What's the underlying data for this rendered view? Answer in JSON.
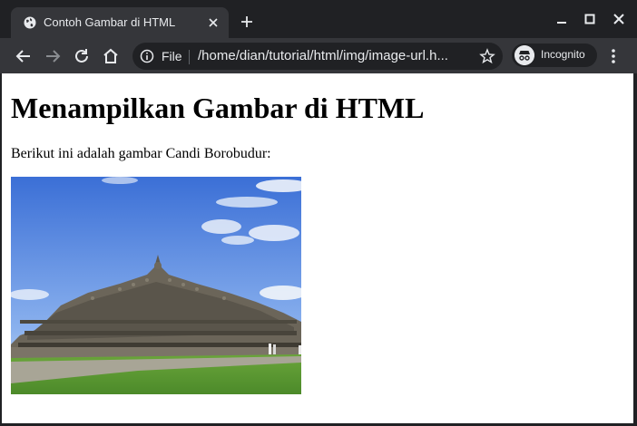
{
  "browser": {
    "tab": {
      "title": "Contoh Gambar di HTML",
      "favicon": "globe-icon",
      "close_icon": "close-icon"
    },
    "new_tab_icon": "plus-icon",
    "window_controls": [
      "minimize-icon",
      "maximize-icon",
      "close-icon"
    ],
    "toolbar": {
      "back_icon": "arrow-left-icon",
      "forward_icon": "arrow-right-icon",
      "reload_icon": "reload-icon",
      "home_icon": "home-icon",
      "omnibox": {
        "info_icon": "info-icon",
        "scheme_label": "File",
        "url": "/home/dian/tutorial/html/img/image-url.h...",
        "bookmark_icon": "star-icon"
      },
      "profile_label": "Incognito",
      "menu_icon": "kebab-menu-icon"
    },
    "colors": {
      "frame": "#202124",
      "toolbar": "#35363a",
      "text": "#e8eaed",
      "page": "#ffffff"
    }
  },
  "page": {
    "heading": "Menampilkan Gambar di HTML",
    "paragraph": "Berikut ini adalah gambar Candi Borobudur:",
    "image": {
      "alt": "Candi Borobudur",
      "subject": "borobudur-temple-photo"
    }
  }
}
